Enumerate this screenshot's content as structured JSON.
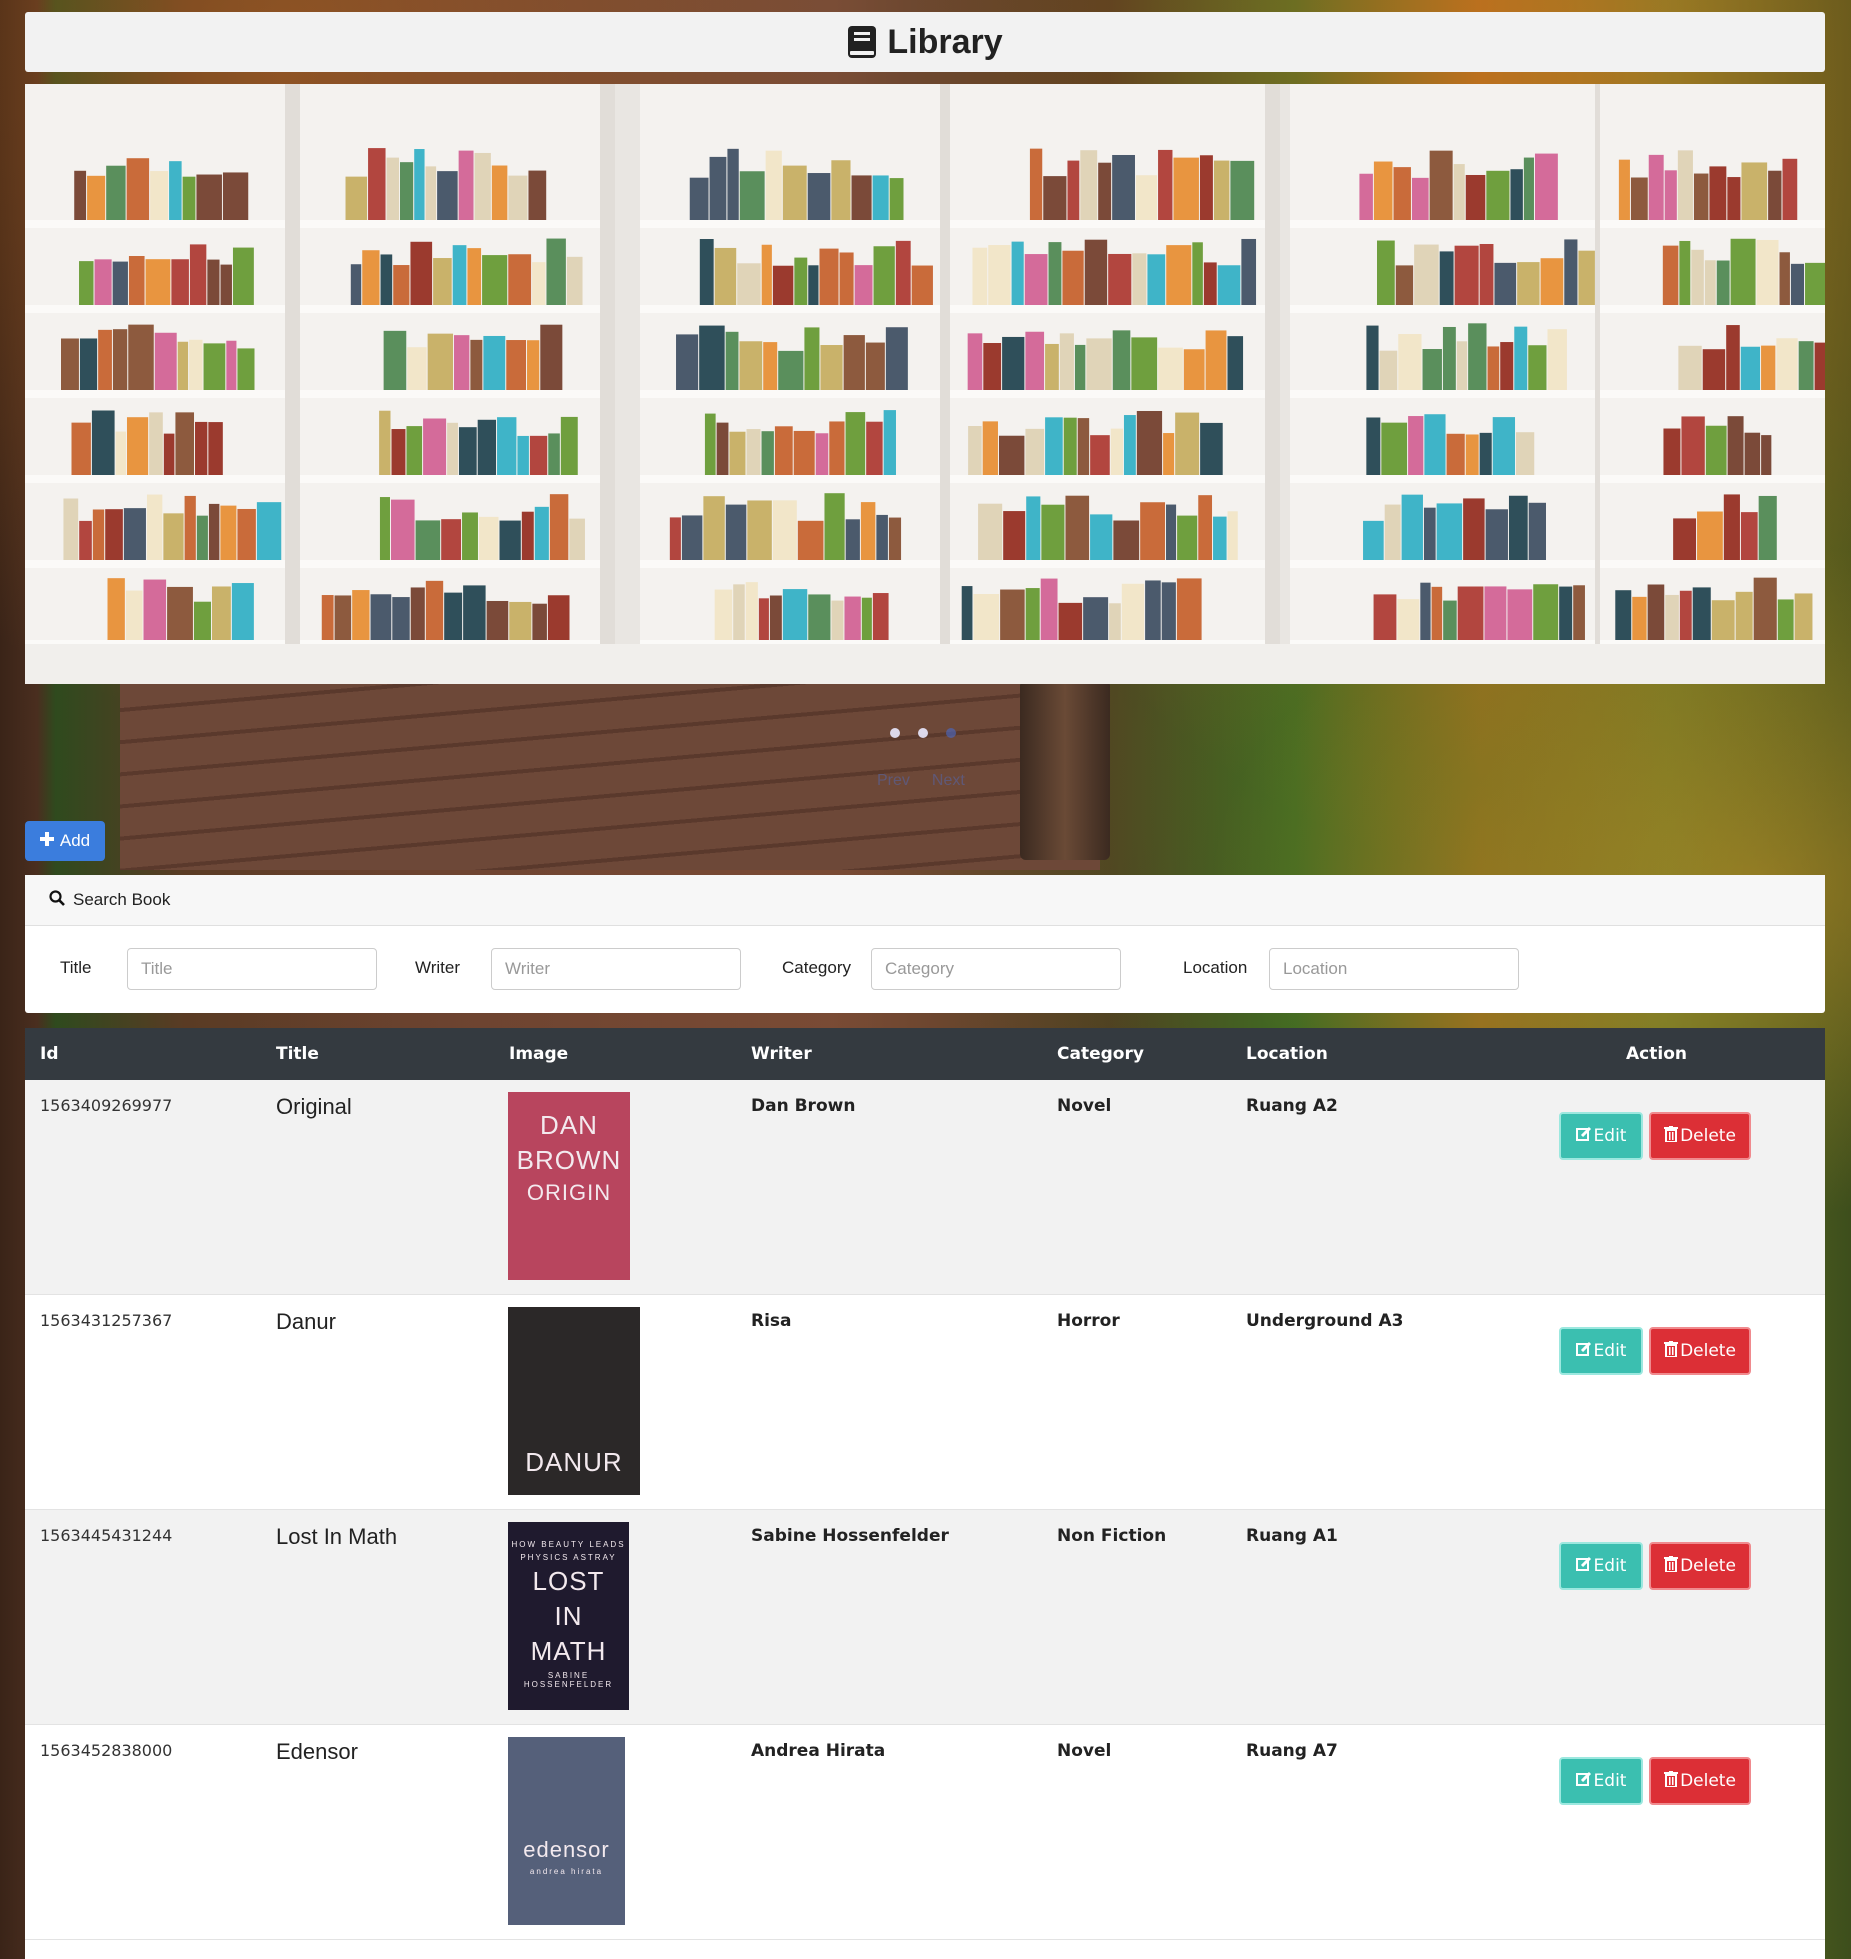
{
  "app": {
    "title": "Library"
  },
  "carousel": {
    "prev_label": "Prev",
    "next_label": "Next",
    "slide_count": 3,
    "active_slide": 3
  },
  "toolbar": {
    "add_label": "Add"
  },
  "search": {
    "header": "Search Book",
    "fields": [
      {
        "label": "Title",
        "placeholder": "Title"
      },
      {
        "label": "Writer",
        "placeholder": "Writer"
      },
      {
        "label": "Category",
        "placeholder": "Category"
      },
      {
        "label": "Location",
        "placeholder": "Location"
      }
    ]
  },
  "table": {
    "columns": [
      "Id",
      "Title",
      "Image",
      "Writer",
      "Category",
      "Location",
      "Action"
    ],
    "edit_label": "Edit",
    "delete_label": "Delete",
    "rows": [
      {
        "id": "1563409269977",
        "title": "Original",
        "writer": "Dan Brown",
        "category": "Novel",
        "location": "Ruang A2",
        "cover": {
          "lines": [
            "DAN",
            "BROWN",
            "ORIGIN"
          ],
          "color": "#b8455e"
        }
      },
      {
        "id": "1563431257367",
        "title": "Danur",
        "writer": "Risa",
        "category": "Horror",
        "location": "Underground A3",
        "cover": {
          "lines": [
            "DANUR"
          ],
          "color": "#2b2828"
        }
      },
      {
        "id": "1563445431244",
        "title": "Lost In Math",
        "writer": "Sabine Hossenfelder",
        "category": "Non Fiction",
        "location": "Ruang A1",
        "cover": {
          "lines": [
            "HOW BEAUTY LEADS",
            "PHYSICS ASTRAY",
            "LOST",
            "IN",
            "MATH",
            "SABINE HOSSENFELDER"
          ],
          "color": "#1f1a2e"
        }
      },
      {
        "id": "1563452838000",
        "title": "Edensor",
        "writer": "Andrea Hirata",
        "category": "Novel",
        "location": "Ruang A7",
        "cover": {
          "lines": [
            "edensor",
            "andrea hirata"
          ],
          "color": "#55607a"
        }
      }
    ]
  },
  "colors": {
    "primary": "#3b7ddd",
    "edit": "#3bbfb0",
    "delete": "#dc2f36",
    "table_header": "#343a40"
  },
  "icons": {
    "header": "book-icon",
    "search": "search-icon",
    "add": "plus-icon",
    "edit": "edit-icon",
    "delete": "trash-icon"
  }
}
